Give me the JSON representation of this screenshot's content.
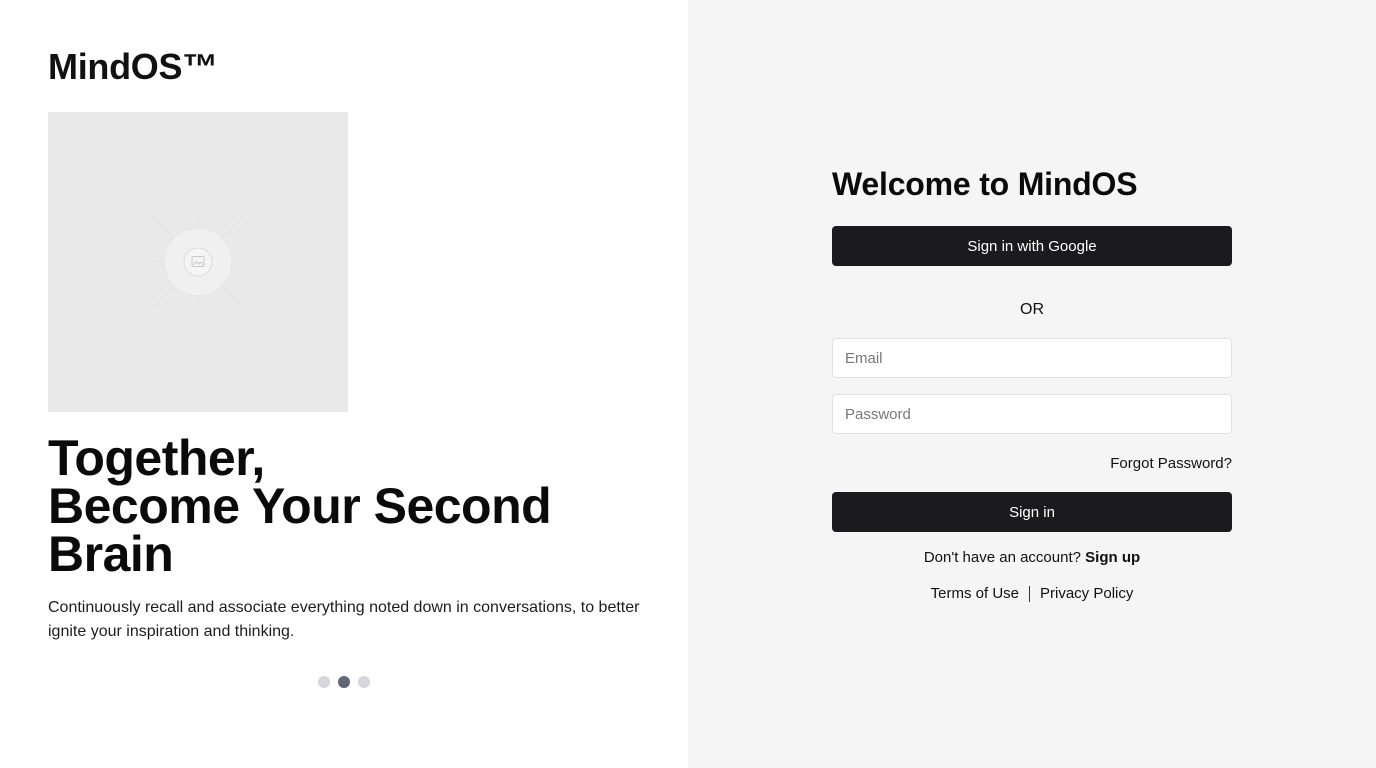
{
  "brand": {
    "name": "MindOS™"
  },
  "hero": {
    "image_icon": "image-placeholder-icon",
    "headline_lines": [
      "Together,",
      "Become Your Second",
      "Brain"
    ],
    "description": "Continuously recall and associate everything noted down in conversations, to better ignite your inspiration and thinking.",
    "carousel": {
      "slide_count": 3,
      "active_index": 1
    }
  },
  "login": {
    "title": "Welcome to MindOS",
    "google_button_label": "Sign in with Google",
    "or_label": "OR",
    "email": {
      "placeholder": "Email",
      "value": ""
    },
    "password": {
      "placeholder": "Password",
      "value": ""
    },
    "forgot_password_label": "Forgot Password?",
    "signin_button_label": "Sign in",
    "no_account_text": "Don't have an account?",
    "signup_label": "Sign up",
    "terms_label": "Terms of Use",
    "privacy_label": "Privacy Policy"
  },
  "colors": {
    "left_background": "#ffffff",
    "right_background": "#f4f5f4",
    "button_background": "#1b1b1d",
    "image_placeholder": "#e9e9e9",
    "dot_inactive": "#d3d6dc",
    "dot_active": "#5e6678"
  }
}
